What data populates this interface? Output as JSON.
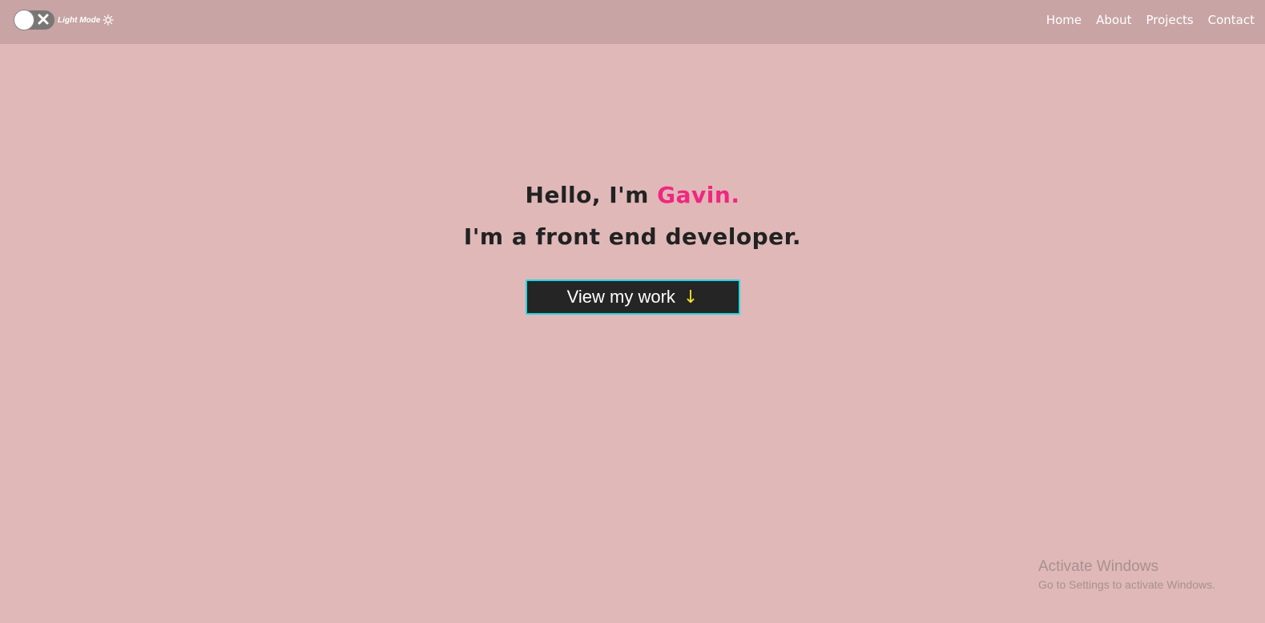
{
  "navbar": {
    "mode_label": "Light Mode",
    "links": [
      "Home",
      "About",
      "Projects",
      "Contact"
    ]
  },
  "hero": {
    "greeting_prefix": "Hello, I'm ",
    "name": "Gavin.",
    "tagline": "I'm a front end developer.",
    "cta_label": "View my work",
    "cta_arrow": "↓"
  },
  "watermark": {
    "title": "Activate Windows",
    "subtitle": "Go to Settings to activate Windows."
  },
  "colors": {
    "background": "#e0b8b8",
    "navbar": "#c8a4a4",
    "accent_name": "#f0277f",
    "button_bg": "#252525",
    "button_border": "#1fd8e6",
    "arrow": "#f5e22a"
  },
  "icons": [
    "close-icon",
    "sun-icon",
    "arrow-down-icon"
  ]
}
